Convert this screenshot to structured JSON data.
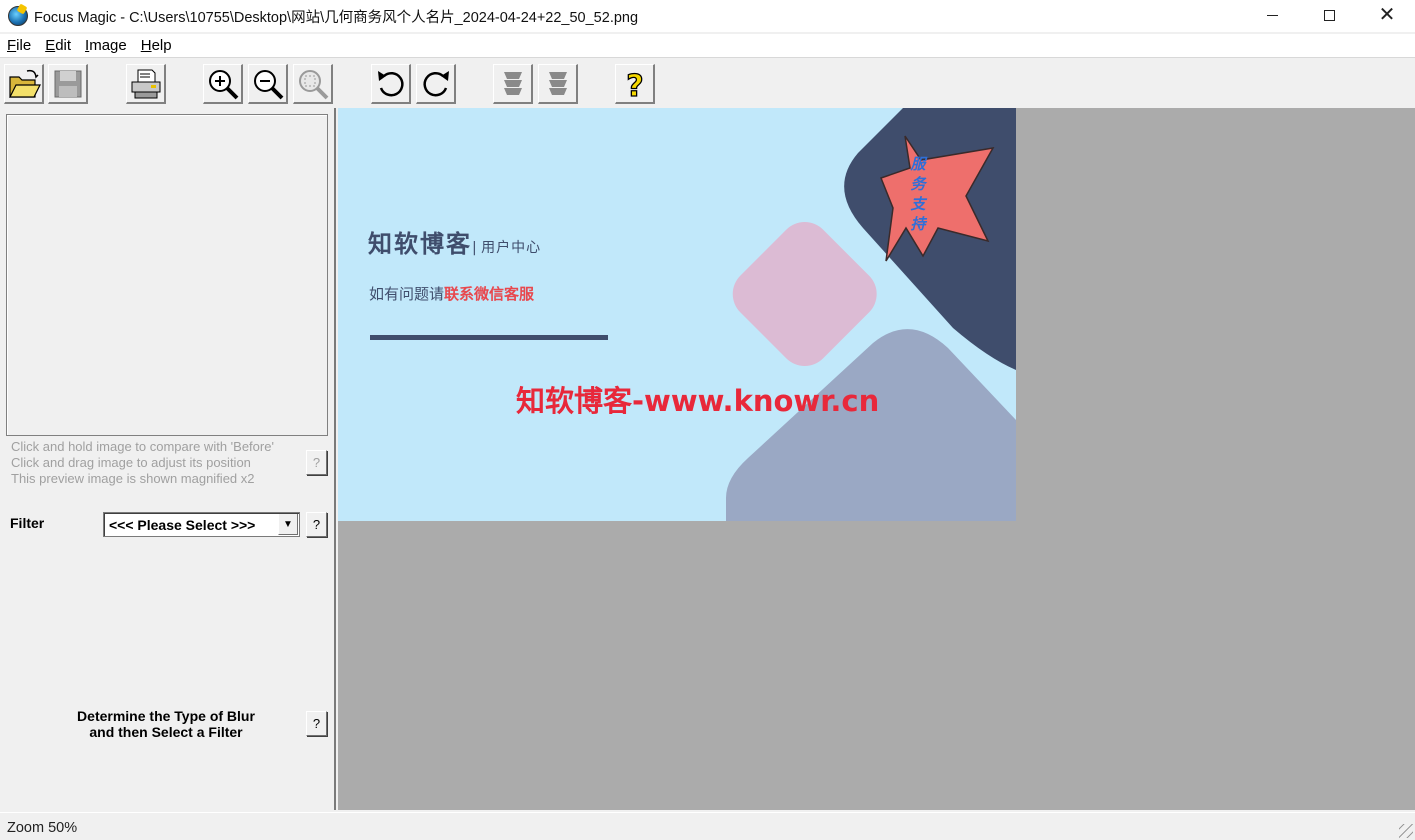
{
  "window": {
    "title": "Focus Magic - C:\\Users\\10755\\Desktop\\网站\\几何商务风个人名片_2024-04-24+22_50_52.png",
    "close_glyph": "✕"
  },
  "menu": [
    {
      "label": "File",
      "accel": "F",
      "rest": "ile"
    },
    {
      "label": "Edit",
      "accel": "E",
      "rest": "dit"
    },
    {
      "label": "Image",
      "accel": "I",
      "rest": "mage"
    },
    {
      "label": "Help",
      "accel": "H",
      "rest": "elp"
    }
  ],
  "toolbar": {
    "icons": [
      "open-folder-icon",
      "save-disk-icon",
      "printer-icon",
      "zoom-in-icon",
      "zoom-out-icon",
      "zoom-fit-icon",
      "rotate-left-icon",
      "rotate-right-icon",
      "blur-filter-1-icon",
      "blur-filter-2-icon",
      "help-question-icon"
    ]
  },
  "left_panel": {
    "hints": [
      "Click and hold image to compare with 'Before'",
      "Click and drag image to adjust its position",
      "This preview image is shown magnified x2"
    ],
    "help_glyph": "?",
    "filter_label": "Filter",
    "filter_selected": "<<< Please Select >>>",
    "dropdown_glyph": "▼",
    "blur_instruction_line1": "Determine the Type of Blur",
    "blur_instruction_line2": "and then Select a Filter"
  },
  "image": {
    "brand": "知软博客",
    "sep_sub": "用户中心",
    "contact_prefix": "如有问题请",
    "contact_highlight": "联系微信客服",
    "watermark": "知软博客-www.knowr.cn",
    "badge_text": "服务支持",
    "colors": {
      "background": "#c1e8fa",
      "dark_navy": "#3f4d6c",
      "pink": "#dcbbd4",
      "slate": "#9aa8c4",
      "red": "#e8484e",
      "star": "#ee6f6c"
    }
  },
  "statusbar": {
    "zoom_text": "Zoom 50%"
  }
}
